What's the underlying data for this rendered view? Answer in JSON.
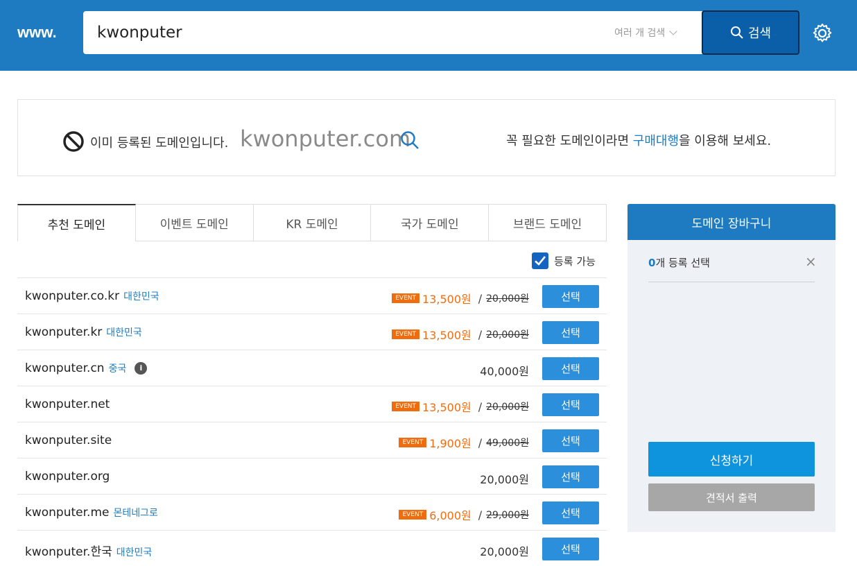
{
  "header": {
    "prefix": "www.",
    "search_value": "kwonputer",
    "multi_search_label": "여러 개 검색",
    "search_button_label": "검색"
  },
  "notice": {
    "message": "이미 등록된 도메인입니다.",
    "domain": "kwonputer.com",
    "right_prefix": "꼭 필요한 도메인이라면 ",
    "right_link": "구매대행",
    "right_suffix": "을 이용해 보세요."
  },
  "tabs": [
    {
      "label": "추천 도메인",
      "active": true
    },
    {
      "label": "이벤트 도메인",
      "active": false
    },
    {
      "label": "KR 도메인",
      "active": false
    },
    {
      "label": "국가 도메인",
      "active": false
    },
    {
      "label": "브랜드 도메인",
      "active": false
    }
  ],
  "filter": {
    "available_label": "등록 가능",
    "checked": true
  },
  "select_label": "선택",
  "domains": [
    {
      "name": "kwonputer.co.kr",
      "country": "대한민국",
      "event": true,
      "event_label": "EVENT",
      "price": "13,500원",
      "original": "20,000원"
    },
    {
      "name": "kwonputer.kr",
      "country": "대한민국",
      "event": true,
      "event_label": "EVENT",
      "price": "13,500원",
      "original": "20,000원"
    },
    {
      "name": "kwonputer.cn",
      "country": "중국",
      "info": "i",
      "event": false,
      "price": "40,000원"
    },
    {
      "name": "kwonputer.net",
      "country": "",
      "event": true,
      "event_label": "EVENT",
      "price": "13,500원",
      "original": "20,000원"
    },
    {
      "name": "kwonputer.site",
      "country": "",
      "event": true,
      "event_label": "EVENT",
      "price": "1,900원",
      "original": "49,000원"
    },
    {
      "name": "kwonputer.org",
      "country": "",
      "event": false,
      "price": "20,000원"
    },
    {
      "name": "kwonputer.me",
      "country": "몬테네그로",
      "event": true,
      "event_label": "EVENT",
      "price": "6,000원",
      "original": "29,000원"
    },
    {
      "name": "kwonputer.한국",
      "country": "대한민국",
      "event": false,
      "price": "20,000원"
    }
  ],
  "cart": {
    "title": "도메인 장바구니",
    "count": "0",
    "count_suffix": "개 등록 선택",
    "close": "×",
    "apply_label": "신청하기",
    "quote_label": "견적서 출력"
  },
  "colors": {
    "brand": "#1f7bc1",
    "event": "#ee6d10",
    "button": "#2b8fdb"
  }
}
